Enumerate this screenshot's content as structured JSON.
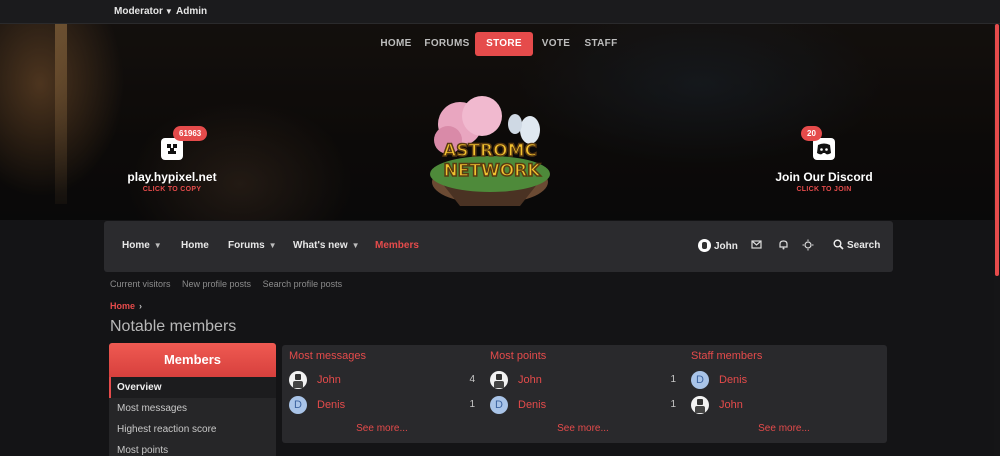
{
  "topbar": {
    "moderator": "Moderator",
    "admin": "Admin"
  },
  "topnav": [
    "HOME",
    "FORUMS",
    "STORE",
    "VOTE",
    "STAFF"
  ],
  "server": {
    "badge": "61963",
    "ip": "play.hypixel.net",
    "sub": "CLICK TO COPY"
  },
  "discord": {
    "badge": "20",
    "title": "Join Our Discord",
    "sub": "CLICK TO JOIN"
  },
  "logo": {
    "line1": "ASTROMC",
    "line2": "NETWORK"
  },
  "mainnav": {
    "home1": "Home",
    "home2": "Home",
    "forums": "Forums",
    "whats_new": "What's new",
    "members": "Members",
    "user": "John",
    "search": "Search"
  },
  "subnav": [
    "Current visitors",
    "New profile posts",
    "Search profile posts"
  ],
  "breadcrumb": "Home",
  "page_title": "Notable members",
  "sidebar": {
    "title": "Members",
    "items": [
      "Overview",
      "Most messages",
      "Highest reaction score",
      "Most points"
    ]
  },
  "columns": [
    {
      "title": "Most messages",
      "rows": [
        {
          "name": "John",
          "count": "4",
          "avatar": "image"
        },
        {
          "name": "Denis",
          "count": "1",
          "avatar": "D"
        }
      ],
      "more": "See more..."
    },
    {
      "title": "Most points",
      "rows": [
        {
          "name": "John",
          "count": "1",
          "avatar": "image"
        },
        {
          "name": "Denis",
          "count": "1",
          "avatar": "D"
        }
      ],
      "more": "See more..."
    },
    {
      "title": "Staff members",
      "rows": [
        {
          "name": "Denis",
          "count": "",
          "avatar": "D"
        },
        {
          "name": "John",
          "count": "",
          "avatar": "image"
        }
      ],
      "more": "See more..."
    }
  ],
  "colors": {
    "accent": "#e54b4b",
    "panel": "#29292c",
    "nav": "#2b2b2e"
  }
}
